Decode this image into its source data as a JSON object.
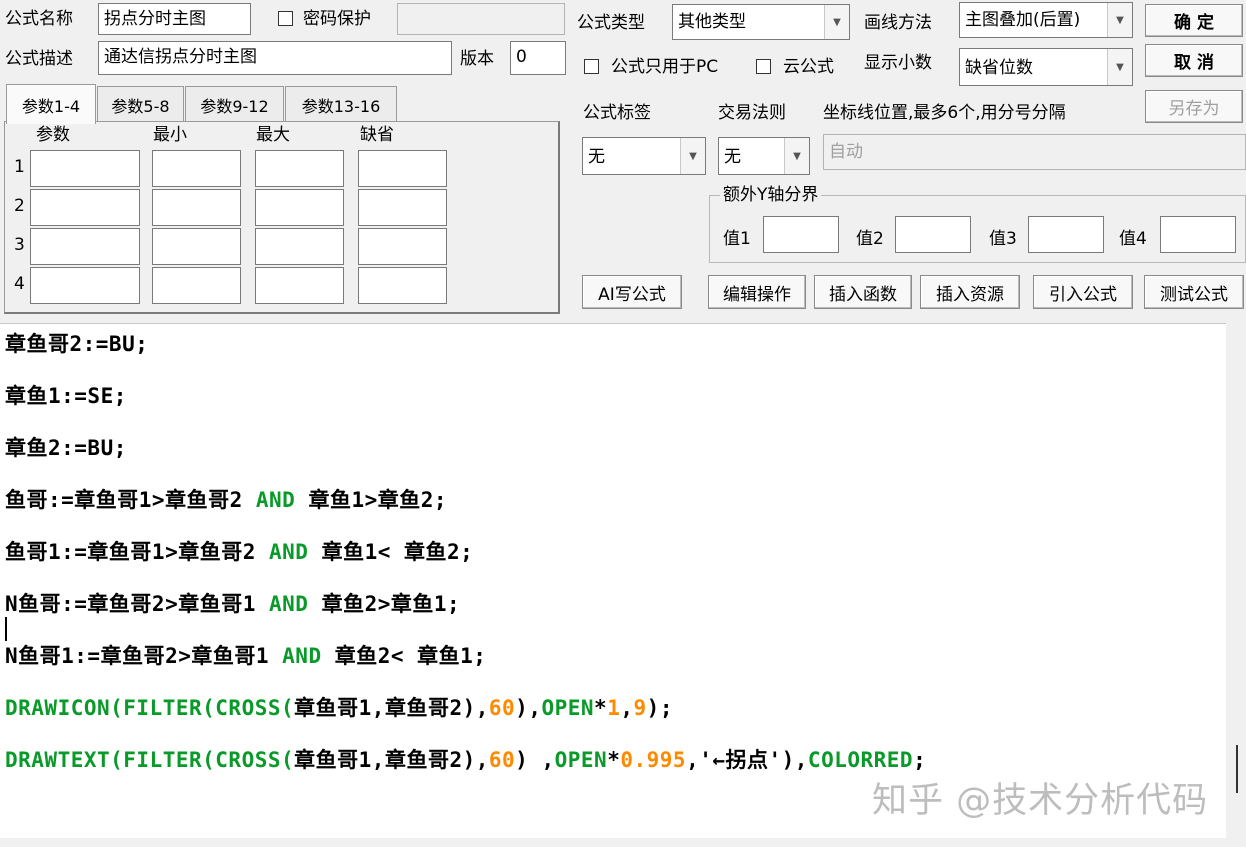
{
  "header": {
    "name_label": "公式名称",
    "name_value": "拐点分时主图",
    "password_label": "密码保护",
    "desc_label": "公式描述",
    "desc_value": "通达信拐点分时主图",
    "version_label": "版本",
    "version_value": "0",
    "type_label": "公式类型",
    "type_value": "其他类型",
    "draw_label": "画线方法",
    "draw_value": "主图叠加(后置)",
    "pc_only_label": "公式只用于PC",
    "cloud_label": "云公式",
    "decimals_label": "显示小数",
    "decimals_value": "缺省位数"
  },
  "buttons": {
    "ok": "确  定",
    "cancel": "取  消",
    "save_as": "另存为",
    "ai": "AI写公式",
    "edit": "编辑操作",
    "insert_func": "插入函数",
    "insert_res": "插入资源",
    "import": "引入公式",
    "test": "测试公式"
  },
  "tabs": [
    "参数1-4",
    "参数5-8",
    "参数9-12",
    "参数13-16"
  ],
  "params": {
    "col_param": "参数",
    "col_min": "最小",
    "col_max": "最大",
    "col_default": "缺省",
    "rows": [
      "1",
      "2",
      "3",
      "4"
    ]
  },
  "right": {
    "tag_label": "公式标签",
    "rule_label": "交易法则",
    "axis_label": "坐标线位置,最多6个,用分号分隔",
    "tag_value": "无",
    "rule_value": "无",
    "axis_placeholder": "自动",
    "extra_y_title": "额外Y轴分界",
    "v1": "值1",
    "v2": "值2",
    "v3": "值3",
    "v4": "值4"
  },
  "code_lines": [
    [
      {
        "t": "章鱼哥2:=BU;",
        "c": ""
      }
    ],
    [
      {
        "t": "章鱼1:=SE;",
        "c": ""
      }
    ],
    [
      {
        "t": "章鱼2:=BU;",
        "c": ""
      }
    ],
    [
      {
        "t": "鱼哥:=章鱼哥1>章鱼哥2 ",
        "c": ""
      },
      {
        "t": "AND",
        "c": "kw"
      },
      {
        "t": " 章鱼1>章鱼2;",
        "c": ""
      }
    ],
    [
      {
        "t": "鱼哥1:=章鱼哥1>章鱼哥2 ",
        "c": ""
      },
      {
        "t": "AND",
        "c": "kw"
      },
      {
        "t": " 章鱼1< 章鱼2;",
        "c": ""
      }
    ],
    [
      {
        "t": "N鱼哥:=章鱼哥2>章鱼哥1 ",
        "c": ""
      },
      {
        "t": "AND",
        "c": "kw"
      },
      {
        "t": " 章鱼2>章鱼1;",
        "c": ""
      }
    ],
    [
      {
        "t": "N鱼哥1:=章鱼哥2>章鱼哥1 ",
        "c": ""
      },
      {
        "t": "AND",
        "c": "kw"
      },
      {
        "t": " 章鱼2< 章鱼1;",
        "c": ""
      }
    ],
    [
      {
        "t": "DRAWICON(FILTER(CROSS(",
        "c": "kw"
      },
      {
        "t": "章鱼哥1,章鱼哥2),",
        "c": ""
      },
      {
        "t": "60",
        "c": "num"
      },
      {
        "t": "),",
        "c": ""
      },
      {
        "t": "OPEN",
        "c": "kw"
      },
      {
        "t": "*",
        "c": ""
      },
      {
        "t": "1",
        "c": "num"
      },
      {
        "t": ",",
        "c": ""
      },
      {
        "t": "9",
        "c": "num"
      },
      {
        "t": ");",
        "c": ""
      }
    ],
    [
      {
        "t": "DRAWTEXT(FILTER(CROSS(",
        "c": "kw"
      },
      {
        "t": "章鱼哥1,章鱼哥2),",
        "c": ""
      },
      {
        "t": "60",
        "c": "num"
      },
      {
        "t": ") ,",
        "c": ""
      },
      {
        "t": "OPEN",
        "c": "kw"
      },
      {
        "t": "*",
        "c": ""
      },
      {
        "t": "0.995",
        "c": "num"
      },
      {
        "t": ",'←拐点'),",
        "c": ""
      },
      {
        "t": "COLORRED",
        "c": "kw"
      },
      {
        "t": ";",
        "c": ""
      }
    ]
  ],
  "watermark": "知乎 @技术分析代码"
}
